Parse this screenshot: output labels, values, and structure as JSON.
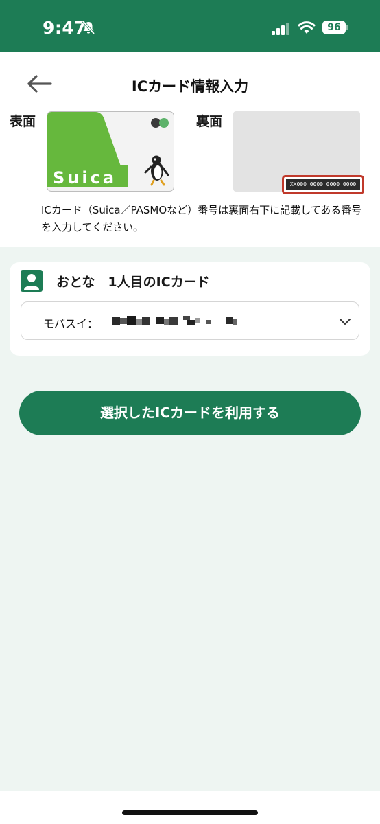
{
  "status_bar": {
    "time": "9:47",
    "battery": "96"
  },
  "header": {
    "title": "ICカード情報入力"
  },
  "card_preview": {
    "front_label": "表面",
    "back_label": "裏面",
    "card_brand": "Suica",
    "card_number": "XX000 0000 0000 0000",
    "hint": "ICカード（Suica／PASMOなど）番号は裏面右下に記載してある番号を入力してください。"
  },
  "selection": {
    "title": "おとな　1人目のICカード",
    "dropdown_prefix": "モバスイ："
  },
  "actions": {
    "use_card_label": "選択したICカードを利用する"
  },
  "colors": {
    "brand_green": "#1d7c55",
    "suica_green": "#66b83d",
    "highlight_red": "#c0392b"
  }
}
